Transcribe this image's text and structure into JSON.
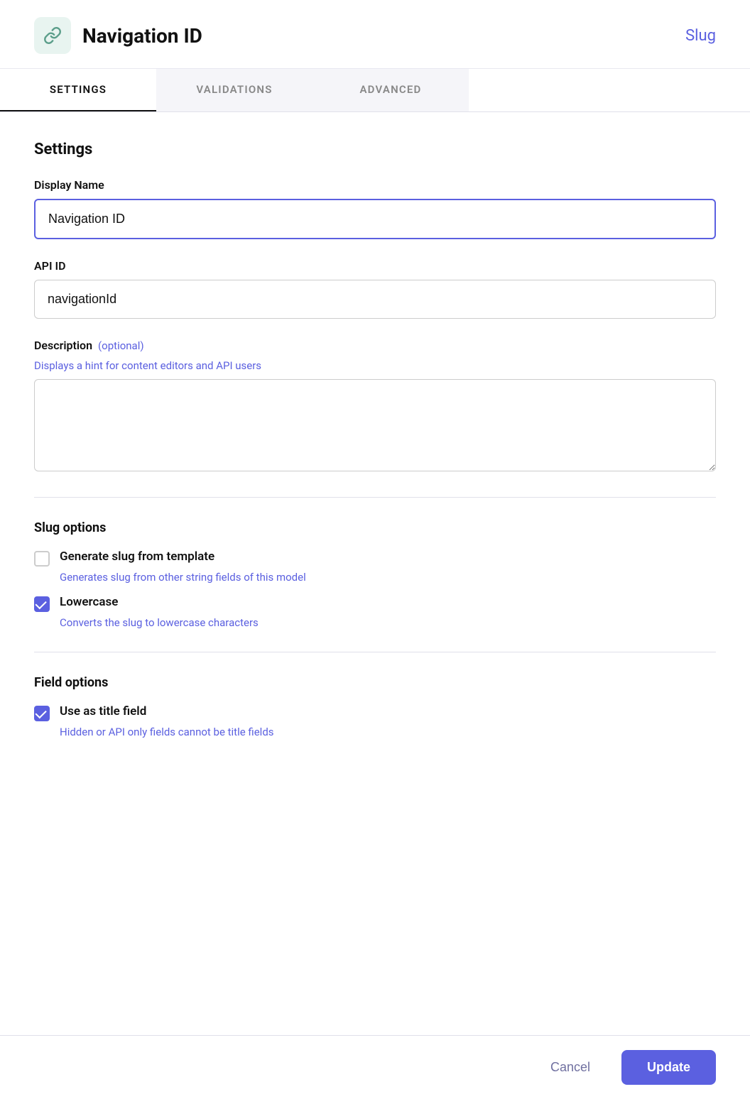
{
  "header": {
    "title": "Navigation ID",
    "slug_label": "Slug",
    "icon_alt": "link-icon"
  },
  "tabs": [
    {
      "id": "settings",
      "label": "SETTINGS",
      "active": true
    },
    {
      "id": "validations",
      "label": "VALIDATIONS",
      "active": false
    },
    {
      "id": "advanced",
      "label": "ADVANCED",
      "active": false
    }
  ],
  "settings": {
    "section_title": "Settings",
    "display_name": {
      "label": "Display Name",
      "value": "Navigation ID",
      "placeholder": ""
    },
    "api_id": {
      "label": "API ID",
      "value": "navigationId",
      "placeholder": ""
    },
    "description": {
      "label": "Description",
      "optional_label": "(optional)",
      "hint": "Displays a hint for content editors and API users",
      "value": "",
      "placeholder": ""
    },
    "slug_options": {
      "section_title": "Slug options",
      "generate_slug": {
        "label": "Generate slug from template",
        "description": "Generates slug from other string fields of this model",
        "checked": false
      },
      "lowercase": {
        "label": "Lowercase",
        "description": "Converts the slug to lowercase characters",
        "checked": true
      }
    },
    "field_options": {
      "section_title": "Field options",
      "use_as_title": {
        "label": "Use as title field",
        "description": "Hidden or API only fields cannot be title fields",
        "checked": true
      }
    }
  },
  "footer": {
    "cancel_label": "Cancel",
    "update_label": "Update"
  }
}
